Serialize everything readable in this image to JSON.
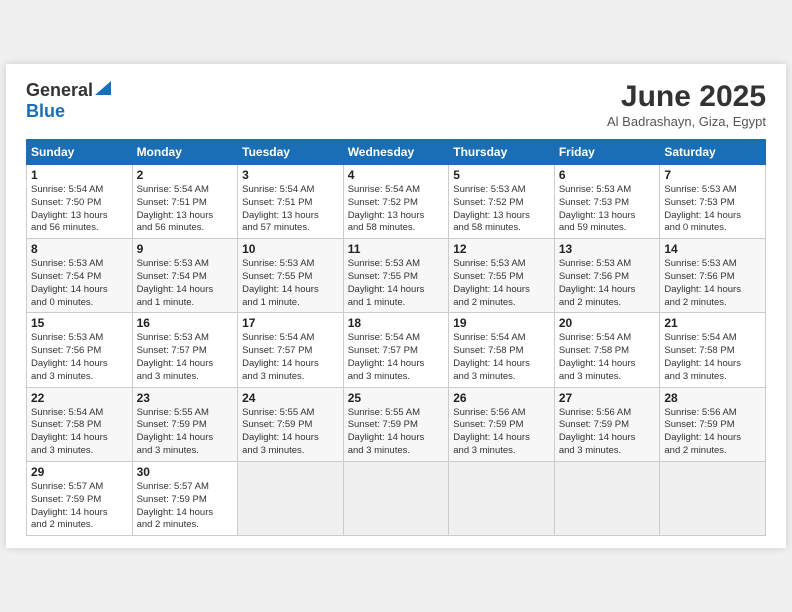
{
  "logo": {
    "text_general": "General",
    "text_blue": "Blue"
  },
  "title": "June 2025",
  "location": "Al Badrashayn, Giza, Egypt",
  "days_of_week": [
    "Sunday",
    "Monday",
    "Tuesday",
    "Wednesday",
    "Thursday",
    "Friday",
    "Saturday"
  ],
  "weeks": [
    [
      {
        "day": "1",
        "info": "Sunrise: 5:54 AM\nSunset: 7:50 PM\nDaylight: 13 hours\nand 56 minutes."
      },
      {
        "day": "2",
        "info": "Sunrise: 5:54 AM\nSunset: 7:51 PM\nDaylight: 13 hours\nand 56 minutes."
      },
      {
        "day": "3",
        "info": "Sunrise: 5:54 AM\nSunset: 7:51 PM\nDaylight: 13 hours\nand 57 minutes."
      },
      {
        "day": "4",
        "info": "Sunrise: 5:54 AM\nSunset: 7:52 PM\nDaylight: 13 hours\nand 58 minutes."
      },
      {
        "day": "5",
        "info": "Sunrise: 5:53 AM\nSunset: 7:52 PM\nDaylight: 13 hours\nand 58 minutes."
      },
      {
        "day": "6",
        "info": "Sunrise: 5:53 AM\nSunset: 7:53 PM\nDaylight: 13 hours\nand 59 minutes."
      },
      {
        "day": "7",
        "info": "Sunrise: 5:53 AM\nSunset: 7:53 PM\nDaylight: 14 hours\nand 0 minutes."
      }
    ],
    [
      {
        "day": "8",
        "info": "Sunrise: 5:53 AM\nSunset: 7:54 PM\nDaylight: 14 hours\nand 0 minutes."
      },
      {
        "day": "9",
        "info": "Sunrise: 5:53 AM\nSunset: 7:54 PM\nDaylight: 14 hours\nand 1 minute."
      },
      {
        "day": "10",
        "info": "Sunrise: 5:53 AM\nSunset: 7:55 PM\nDaylight: 14 hours\nand 1 minute."
      },
      {
        "day": "11",
        "info": "Sunrise: 5:53 AM\nSunset: 7:55 PM\nDaylight: 14 hours\nand 1 minute."
      },
      {
        "day": "12",
        "info": "Sunrise: 5:53 AM\nSunset: 7:55 PM\nDaylight: 14 hours\nand 2 minutes."
      },
      {
        "day": "13",
        "info": "Sunrise: 5:53 AM\nSunset: 7:56 PM\nDaylight: 14 hours\nand 2 minutes."
      },
      {
        "day": "14",
        "info": "Sunrise: 5:53 AM\nSunset: 7:56 PM\nDaylight: 14 hours\nand 2 minutes."
      }
    ],
    [
      {
        "day": "15",
        "info": "Sunrise: 5:53 AM\nSunset: 7:56 PM\nDaylight: 14 hours\nand 3 minutes."
      },
      {
        "day": "16",
        "info": "Sunrise: 5:53 AM\nSunset: 7:57 PM\nDaylight: 14 hours\nand 3 minutes."
      },
      {
        "day": "17",
        "info": "Sunrise: 5:54 AM\nSunset: 7:57 PM\nDaylight: 14 hours\nand 3 minutes."
      },
      {
        "day": "18",
        "info": "Sunrise: 5:54 AM\nSunset: 7:57 PM\nDaylight: 14 hours\nand 3 minutes."
      },
      {
        "day": "19",
        "info": "Sunrise: 5:54 AM\nSunset: 7:58 PM\nDaylight: 14 hours\nand 3 minutes."
      },
      {
        "day": "20",
        "info": "Sunrise: 5:54 AM\nSunset: 7:58 PM\nDaylight: 14 hours\nand 3 minutes."
      },
      {
        "day": "21",
        "info": "Sunrise: 5:54 AM\nSunset: 7:58 PM\nDaylight: 14 hours\nand 3 minutes."
      }
    ],
    [
      {
        "day": "22",
        "info": "Sunrise: 5:54 AM\nSunset: 7:58 PM\nDaylight: 14 hours\nand 3 minutes."
      },
      {
        "day": "23",
        "info": "Sunrise: 5:55 AM\nSunset: 7:59 PM\nDaylight: 14 hours\nand 3 minutes."
      },
      {
        "day": "24",
        "info": "Sunrise: 5:55 AM\nSunset: 7:59 PM\nDaylight: 14 hours\nand 3 minutes."
      },
      {
        "day": "25",
        "info": "Sunrise: 5:55 AM\nSunset: 7:59 PM\nDaylight: 14 hours\nand 3 minutes."
      },
      {
        "day": "26",
        "info": "Sunrise: 5:56 AM\nSunset: 7:59 PM\nDaylight: 14 hours\nand 3 minutes."
      },
      {
        "day": "27",
        "info": "Sunrise: 5:56 AM\nSunset: 7:59 PM\nDaylight: 14 hours\nand 3 minutes."
      },
      {
        "day": "28",
        "info": "Sunrise: 5:56 AM\nSunset: 7:59 PM\nDaylight: 14 hours\nand 2 minutes."
      }
    ],
    [
      {
        "day": "29",
        "info": "Sunrise: 5:57 AM\nSunset: 7:59 PM\nDaylight: 14 hours\nand 2 minutes."
      },
      {
        "day": "30",
        "info": "Sunrise: 5:57 AM\nSunset: 7:59 PM\nDaylight: 14 hours\nand 2 minutes."
      },
      {
        "day": "",
        "info": ""
      },
      {
        "day": "",
        "info": ""
      },
      {
        "day": "",
        "info": ""
      },
      {
        "day": "",
        "info": ""
      },
      {
        "day": "",
        "info": ""
      }
    ]
  ]
}
